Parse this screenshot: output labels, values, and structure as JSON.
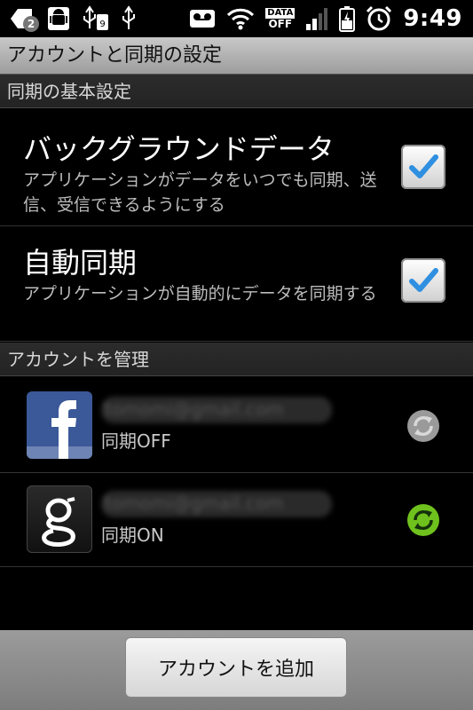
{
  "status_bar": {
    "notification_count": "2",
    "data_label": "DATA",
    "data_state": "OFF",
    "time": "9:49",
    "left_icons": [
      "mail-notification-icon",
      "android-debug-icon",
      "usb-sd-icon",
      "usb-icon"
    ],
    "right_icons": [
      "voicemail-icon",
      "wifi-icon",
      "data-off-icon",
      "signal-icon",
      "battery-icon",
      "alarm-icon"
    ]
  },
  "title_bar": {
    "title": "アカウントと同期の設定"
  },
  "sync_settings": {
    "section_header": "同期の基本設定",
    "items": [
      {
        "title": "バックグラウンドデータ",
        "description": "アプリケーションがデータをいつでも同期、送信、受信できるようにする",
        "checked": true
      },
      {
        "title": "自動同期",
        "description": "アプリケーションが自動的にデータを同期する",
        "checked": true
      }
    ]
  },
  "accounts": {
    "section_header": "アカウントを管理",
    "items": [
      {
        "service": "facebook",
        "email": "tomomi@gmail.com",
        "status": "同期OFF",
        "sync_on": false
      },
      {
        "service": "google",
        "email": "tomomi@gmail.com",
        "status": "同期ON",
        "sync_on": true
      }
    ]
  },
  "footer": {
    "add_account_label": "アカウントを追加"
  },
  "colors": {
    "checkmark": "#2f8fe0",
    "sync_on": "#6fc21d",
    "sync_off": "#9a9a9a",
    "facebook_blue": "#3b5998"
  }
}
